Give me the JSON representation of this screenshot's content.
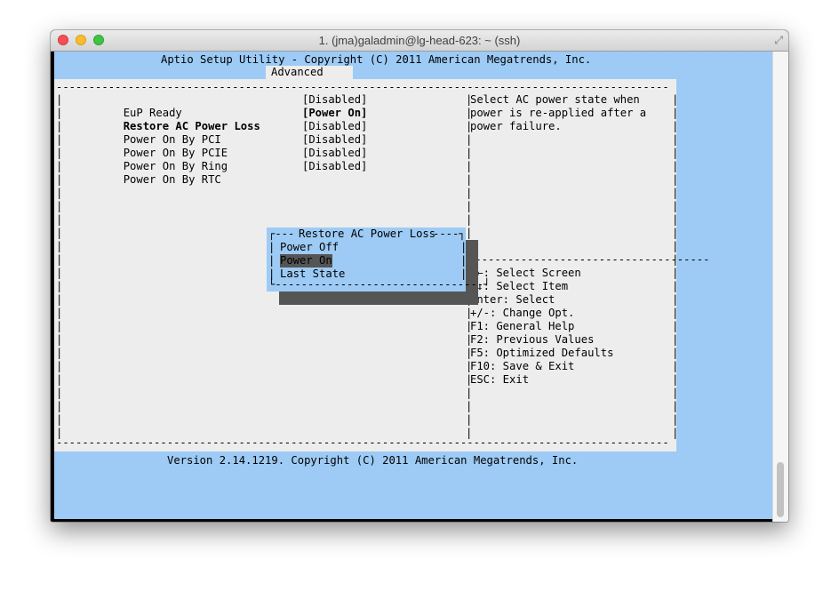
{
  "window": {
    "title": "1. (jma)galadmin@lg-head-623: ~ (ssh)"
  },
  "bios": {
    "header": "Aptio Setup Utility - Copyright (C) 2011 American Megatrends, Inc.",
    "active_tab": "Advanced",
    "settings": [
      {
        "label": "EuP Ready",
        "value": "[Disabled]"
      },
      {
        "label": "Restore AC Power Loss",
        "value": "[Power On]"
      },
      {
        "label": "Power On By PCI",
        "value": "[Disabled]"
      },
      {
        "label": "Power On By PCIE",
        "value": "[Disabled]"
      },
      {
        "label": "Power On By Ring",
        "value": "[Disabled]"
      },
      {
        "label": "Power On By RTC",
        "value": "[Disabled]"
      }
    ],
    "help_text": [
      "Select AC power state when",
      "power is re-applied after a",
      "power failure."
    ],
    "keys": [
      "→←: Select Screen",
      "↑↓: Select Item",
      "Enter: Select",
      "+/-: Change Opt.",
      "F1: General Help",
      "F2: Previous Values",
      "F5: Optimized Defaults",
      "F10: Save & Exit",
      "ESC: Exit"
    ],
    "popup": {
      "title": "Restore AC Power Loss",
      "options": [
        "Power Off",
        "Power On",
        "Last State"
      ],
      "selected": "Power On"
    },
    "footer": "Version 2.14.1219. Copyright (C) 2011 American Megatrends, Inc."
  },
  "colors": {
    "terminal_bg": "#9dcbf5",
    "panel_bg": "#ededed",
    "highlight": "#555555"
  }
}
